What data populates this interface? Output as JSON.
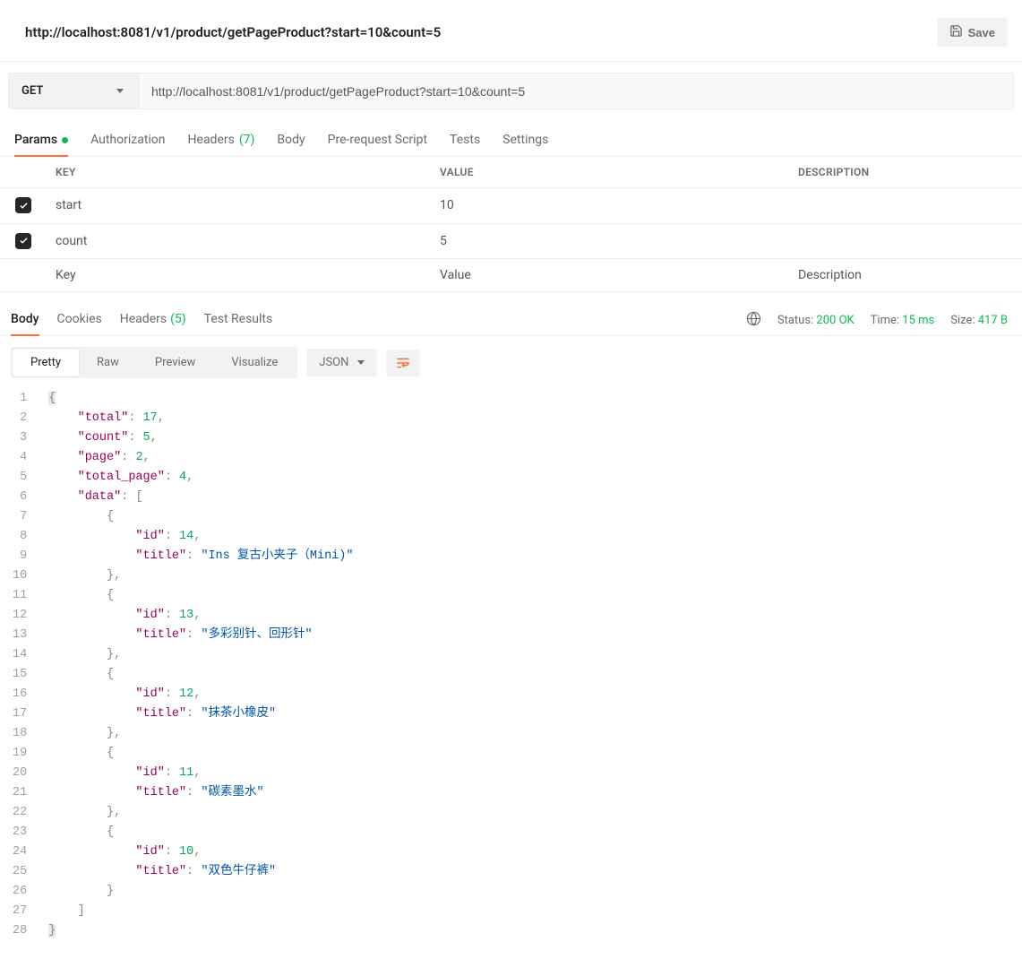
{
  "title": "http://localhost:8081/v1/product/getPageProduct?start=10&count=5",
  "save_label": "Save",
  "method": "GET",
  "url": "http://localhost:8081/v1/product/getPageProduct?start=10&count=5",
  "req_tabs": {
    "params": "Params",
    "auth": "Authorization",
    "headers": "Headers",
    "headers_count": "(7)",
    "body": "Body",
    "prerequest": "Pre-request Script",
    "tests": "Tests",
    "settings": "Settings"
  },
  "params_table": {
    "head_key": "KEY",
    "head_value": "VALUE",
    "head_desc": "DESCRIPTION",
    "rows": [
      {
        "key": "start",
        "value": "10"
      },
      {
        "key": "count",
        "value": "5"
      }
    ],
    "ph_key": "Key",
    "ph_value": "Value",
    "ph_desc": "Description"
  },
  "resp_tabs": {
    "body": "Body",
    "cookies": "Cookies",
    "headers": "Headers",
    "headers_count": "(5)",
    "tests": "Test Results"
  },
  "meta": {
    "status_label": "Status:",
    "status_value": "200 OK",
    "time_label": "Time:",
    "time_value": "15 ms",
    "size_label": "Size:",
    "size_value": "417 B"
  },
  "view": {
    "pretty": "Pretty",
    "raw": "Raw",
    "preview": "Preview",
    "visualize": "Visualize",
    "format": "JSON"
  },
  "json": {
    "total": 17,
    "count": 5,
    "page": 2,
    "total_page": 4,
    "items": [
      {
        "id": 14,
        "title": "Ins 复古小夹子（Mini)"
      },
      {
        "id": 13,
        "title": "多彩别针、回形针"
      },
      {
        "id": 12,
        "title": "抹茶小橡皮"
      },
      {
        "id": 11,
        "title": "碳素墨水"
      },
      {
        "id": 10,
        "title": "双色牛仔裤"
      }
    ]
  }
}
